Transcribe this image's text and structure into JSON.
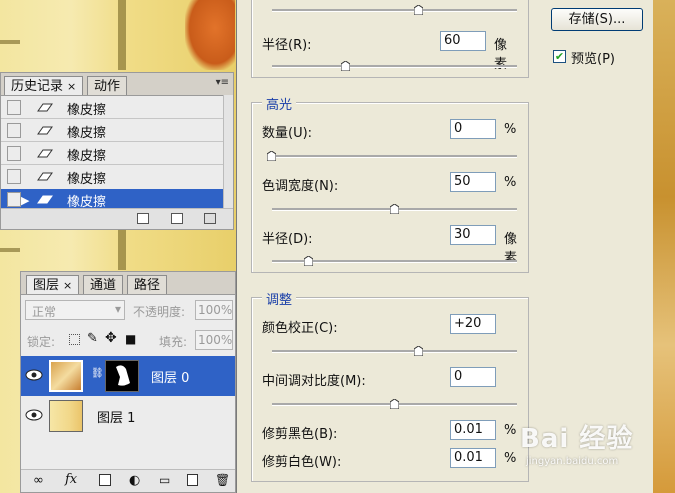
{
  "history_panel": {
    "tabs": [
      {
        "label": "历史记录",
        "close": "×"
      },
      {
        "label": "动作"
      }
    ],
    "menu_icon": "double-arrow-menu-icon",
    "items": [
      {
        "label": "橡皮擦",
        "icon": "eraser-icon"
      },
      {
        "label": "橡皮擦",
        "icon": "eraser-icon"
      },
      {
        "label": "橡皮擦",
        "icon": "eraser-icon"
      },
      {
        "label": "橡皮擦",
        "icon": "eraser-icon"
      },
      {
        "label": "橡皮擦",
        "icon": "eraser-icon",
        "selected": true
      }
    ]
  },
  "layers_panel": {
    "tabs": [
      {
        "label": "图层",
        "close": "×"
      },
      {
        "label": "通道"
      },
      {
        "label": "路径"
      }
    ],
    "blend_mode": "正常",
    "opacity_label": "不透明度:",
    "opacity_value": "100%",
    "lock_label": "锁定:",
    "fill_label": "填充:",
    "fill_value": "100%",
    "layers": [
      {
        "name": "图层 0",
        "selected": true,
        "has_mask": true
      },
      {
        "name": "图层 1",
        "selected": false,
        "has_mask": false
      }
    ],
    "footer_icons": [
      "link-icon",
      "fx-icon",
      "mask-icon",
      "adjustment-icon",
      "group-folder-icon",
      "new-layer-icon",
      "trash-icon"
    ],
    "fx_label": "fx"
  },
  "dialog": {
    "save_button": "存储(S)...",
    "preview_label": "预览(P)",
    "preview_checked": true,
    "top_section": {
      "radius_label": "半径(R):",
      "radius_value": "60",
      "radius_unit": "像素",
      "slider_above_position": 0.6,
      "radius_slider_position": 0.3
    },
    "highlights": {
      "title": "高光",
      "amount_label": "数量(U):",
      "amount_value": "0",
      "amount_unit": "%",
      "amount_slider": 0.0,
      "tonal_width_label": "色调宽度(N):",
      "tonal_width_value": "50",
      "tonal_width_unit": "%",
      "tonal_width_slider": 0.5,
      "radius_label": "半径(D):",
      "radius_value": "30",
      "radius_unit": "像素",
      "radius_slider": 0.15
    },
    "adjustments": {
      "title": "调整",
      "color_correction_label": "颜色校正(C):",
      "color_correction_value": "+20",
      "color_correction_slider": 0.6,
      "midtone_contrast_label": "中间调对比度(M):",
      "midtone_contrast_value": "0",
      "midtone_contrast_slider": 0.5,
      "black_clip_label": "修剪黑色(B):",
      "black_clip_value": "0.01",
      "black_clip_unit": "%",
      "white_clip_label": "修剪白色(W):",
      "white_clip_value": "0.01",
      "white_clip_unit": "%"
    }
  },
  "watermark": {
    "main": "Bai 经验",
    "sub": "jingyan.baidu.com"
  }
}
